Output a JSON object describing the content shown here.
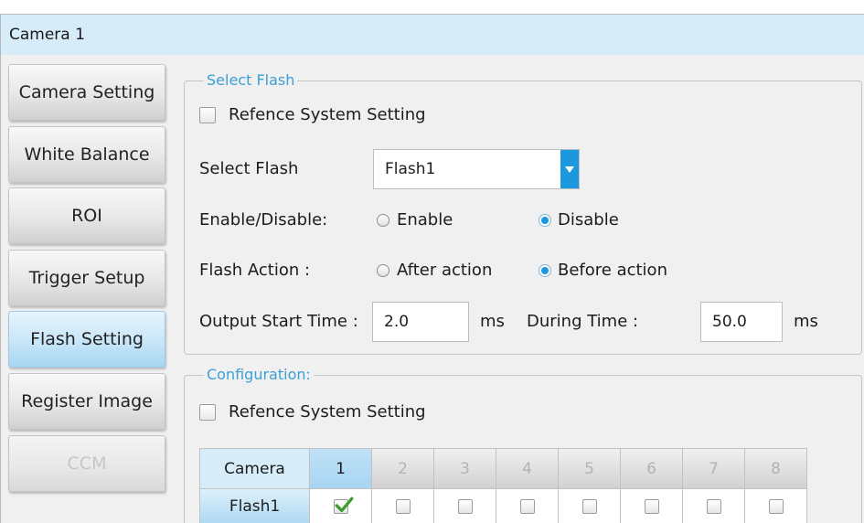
{
  "window": {
    "title": "Camera 1"
  },
  "sidebar": {
    "items": [
      {
        "label": "Camera Setting",
        "selected": false,
        "disabled": false
      },
      {
        "label": "White Balance",
        "selected": false,
        "disabled": false
      },
      {
        "label": "ROI",
        "selected": false,
        "disabled": false
      },
      {
        "label": "Trigger Setup",
        "selected": false,
        "disabled": false
      },
      {
        "label": "Flash Setting",
        "selected": true,
        "disabled": false
      },
      {
        "label": "Register Image",
        "selected": false,
        "disabled": false
      },
      {
        "label": "CCM",
        "selected": false,
        "disabled": true
      }
    ]
  },
  "select_flash": {
    "legend": "Select Flash",
    "reference": {
      "label": "Refence System Setting",
      "checked": false
    },
    "flash_select": {
      "label": "Select Flash",
      "value": "Flash1",
      "icon": "chevron-down-icon"
    },
    "enable": {
      "label": "Enable/Disable:",
      "options": [
        {
          "label": "Enable",
          "selected": false
        },
        {
          "label": "Disable",
          "selected": true
        }
      ]
    },
    "action": {
      "label": "Flash Action :",
      "options": [
        {
          "label": "After action",
          "selected": false
        },
        {
          "label": "Before action",
          "selected": true
        }
      ]
    },
    "output_start": {
      "label": "Output Start Time :",
      "value": "2.0",
      "unit": "ms"
    },
    "during": {
      "label": "During Time :",
      "value": "50.0",
      "unit": "ms"
    }
  },
  "configuration": {
    "legend": "Configuration:",
    "reference": {
      "label": "Refence System Setting",
      "checked": false
    },
    "table": {
      "header_label": "Camera",
      "columns": [
        {
          "label": "1",
          "enabled": true
        },
        {
          "label": "2",
          "enabled": false
        },
        {
          "label": "3",
          "enabled": false
        },
        {
          "label": "4",
          "enabled": false
        },
        {
          "label": "5",
          "enabled": false
        },
        {
          "label": "6",
          "enabled": false
        },
        {
          "label": "7",
          "enabled": false
        },
        {
          "label": "8",
          "enabled": false
        }
      ],
      "rows": [
        {
          "label": "Flash1",
          "checked": [
            true,
            false,
            false,
            false,
            false,
            false,
            false,
            false
          ],
          "check_icon": "check-icon"
        }
      ]
    }
  },
  "colors": {
    "header_bg": "#d6ecf9",
    "panel_bg": "#f0f0f0",
    "accent": "#1b98de",
    "legend_text": "#3c9fd5",
    "selected_tab": "#a7d5f2",
    "check_green": "#3e9b2c"
  }
}
